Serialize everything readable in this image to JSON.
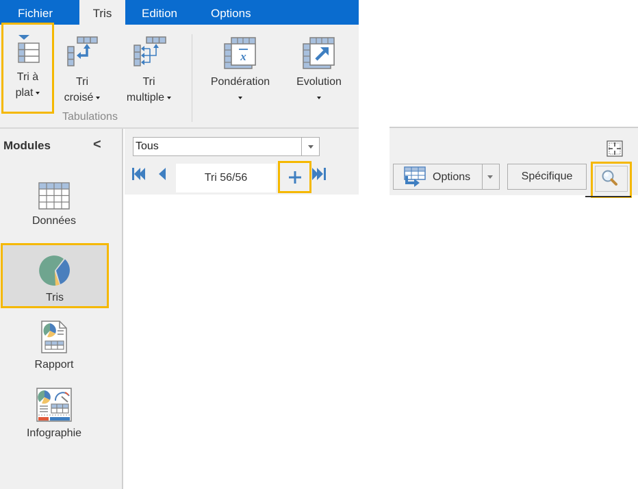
{
  "ribbon": {
    "tabs": [
      {
        "label": "Fichier",
        "active": false
      },
      {
        "label": "Tris",
        "active": true
      },
      {
        "label": "Edition",
        "active": false
      },
      {
        "label": "Options",
        "active": false
      }
    ],
    "buttons": {
      "tri_plat": {
        "line1": "Tri à",
        "line2": "plat",
        "icon": "flat-table-icon",
        "highlighted": true
      },
      "tri_croise": {
        "line1": "Tri",
        "line2": "croisé",
        "icon": "crosstab-icon"
      },
      "tri_multiple": {
        "line1": "Tri",
        "line2": "multiple",
        "icon": "multi-tab-icon"
      },
      "ponderation": {
        "line1": "Pondération",
        "icon": "weighting-icon"
      },
      "evolution": {
        "line1": "Evolution",
        "icon": "evolution-icon"
      }
    },
    "group_label": "Tabulations"
  },
  "sidebar": {
    "title": "Modules",
    "collapse_glyph": "<",
    "items": [
      {
        "label": "Données",
        "icon": "grid-icon",
        "active": false
      },
      {
        "label": "Tris",
        "icon": "pie-chart-icon",
        "active": true
      },
      {
        "label": "Rapport",
        "icon": "report-icon",
        "active": false
      },
      {
        "label": "Infographie",
        "icon": "infographic-icon",
        "active": false
      }
    ]
  },
  "navigator": {
    "filter": {
      "selected": "Tous"
    },
    "counter": "Tri 56/56",
    "add_glyph": "+"
  },
  "right_toolbar": {
    "options_label": "Options",
    "specifique_label": "Spécifique",
    "search_icon": "magnifier-icon",
    "fit_icon": "fit-to-window-icon"
  },
  "colors": {
    "tabbar_blue": "#0a6ccf",
    "highlight": "#f5b800",
    "icon_blue": "#3f7fc1",
    "pie_green": "#6fa58f",
    "pie_blue": "#4a7fbd",
    "pie_yellow": "#f2c366"
  }
}
